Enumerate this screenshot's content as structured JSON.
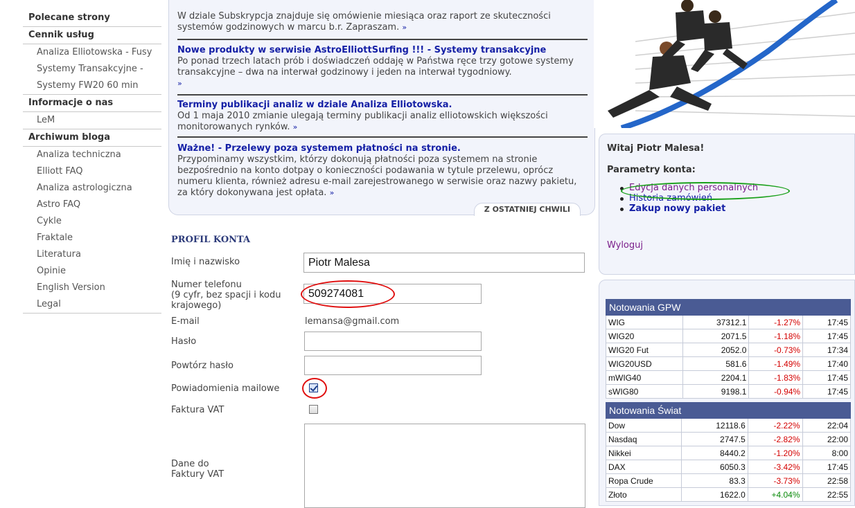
{
  "sidebar": {
    "sections": [
      {
        "title": "Polecane strony",
        "items": []
      },
      {
        "title": "Cennik usług",
        "items": [
          "Analiza Elliotowska - Fusy",
          "Systemy Transakcyjne -",
          "Systemy FW20 60 min"
        ]
      },
      {
        "title": "Informacje o nas",
        "items": [
          "LeM"
        ]
      },
      {
        "title": "Archiwum bloga",
        "items": [
          "Analiza techniczna",
          "Elliott FAQ",
          "Analiza astrologiczna",
          "Astro FAQ",
          "Cykle",
          "Fraktale",
          "Literatura",
          "Opinie",
          "English Version",
          "Legal"
        ]
      }
    ]
  },
  "news": {
    "item0_text": "W dziale Subskrypcja znajduje się omówienie miesiąca oraz raport ze skuteczności systemów godzinowych w marcu b.r. Zapraszam.",
    "item1_title": "Nowe produkty w serwisie AstroElliottSurfing !!! - Systemy transakcyjne",
    "item1_text": "Po ponad trzech latach prób i doświadczeń oddaję w Państwa ręce trzy gotowe systemy transakcyjne – dwa na interwał godzinowy i jeden na interwał tygodniowy.",
    "item2_title": "Terminy publikacji analiz w dziale Analiza Elliotowska.",
    "item2_text": "Od 1 maja 2010 zmianie ulegają terminy publikacji analiz elliotowskich większości monitorowanych rynków.",
    "item3_title": "Ważne! - Przelewy poza systemem płatności na stronie.",
    "item3_text": "Przypominamy wszystkim, którzy dokonują płatności poza systemem na stronie bezpośrednio na konto dotpay o konieczności podawania w tytule przelewu, oprócz numeru klienta, również adresu e-mail zarejestrowanego w serwisie oraz nazwy pakietu, za który dokonywana jest opłata.",
    "more": "»",
    "tab_label": "Z OSTATNIEJ CHWILI"
  },
  "profile": {
    "title": "PROFIL KONTA",
    "name_label": "Imię i nazwisko",
    "name_value": "Piotr Malesa",
    "phone_label1": "Numer telefonu",
    "phone_label2": "(9 cyfr, bez spacji i kodu",
    "phone_label3": "krajowego)",
    "phone_value": "509274081",
    "email_label": "E-mail",
    "email_value": "lemansa@gmail.com",
    "password_label": "Hasło",
    "password_repeat_label": "Powtórz hasło",
    "notifications_label": "Powiadomienia mailowe",
    "notifications_checked": true,
    "invoice_label": "Faktura VAT",
    "invoice_checked": false,
    "invoice_data_label1": "Dane do",
    "invoice_data_label2": "Faktury VAT"
  },
  "account": {
    "welcome": "Witaj Piotr Malesa!",
    "params_title": "Parametry konta:",
    "links": [
      "Edycja danych personalnych",
      "Historia zamówień",
      "Zakup nowy pakiet"
    ],
    "logout": "Wyloguj"
  },
  "quotes_gpw": {
    "title": "Notowania GPW",
    "rows": [
      [
        "WIG",
        "37312.1",
        "-1.27%",
        "17:45"
      ],
      [
        "WIG20",
        "2071.5",
        "-1.18%",
        "17:45"
      ],
      [
        "WIG20 Fut",
        "2052.0",
        "-0.73%",
        "17:34"
      ],
      [
        "WIG20USD",
        "581.6",
        "-1.49%",
        "17:40"
      ],
      [
        "mWIG40",
        "2204.1",
        "-1.83%",
        "17:45"
      ],
      [
        "sWIG80",
        "9198.1",
        "-0.94%",
        "17:45"
      ]
    ]
  },
  "quotes_world": {
    "title": "Notowania Świat",
    "rows": [
      [
        "Dow",
        "12118.6",
        "-2.22%",
        "22:04"
      ],
      [
        "Nasdaq",
        "2747.5",
        "-2.82%",
        "22:00"
      ],
      [
        "Nikkei",
        "8440.2",
        "-1.20%",
        "8:00"
      ],
      [
        "DAX",
        "6050.3",
        "-3.42%",
        "17:45"
      ],
      [
        "Ropa Crude",
        "83.3",
        "-3.73%",
        "22:58"
      ],
      [
        "Złoto",
        "1622.0",
        "+4.04%",
        "22:55"
      ]
    ]
  },
  "colors": {
    "link": "#1520a6",
    "negative": "#d40000",
    "positive": "#0a8a0a",
    "table_header": "#4a5b94",
    "annotation_red": "#e01010",
    "annotation_green": "#1aa01a"
  }
}
